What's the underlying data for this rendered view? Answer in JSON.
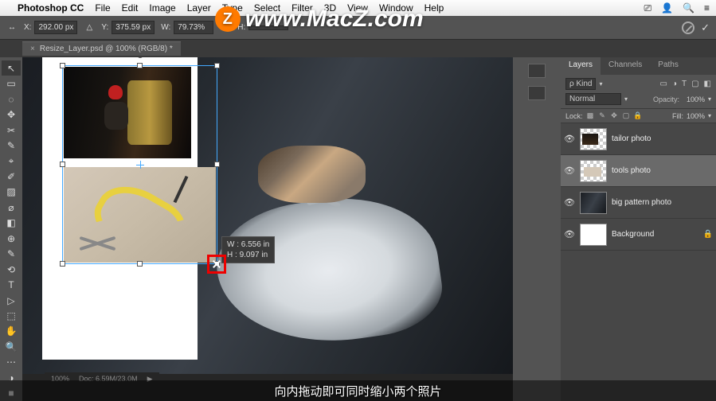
{
  "menubar": {
    "apple": "",
    "app": "Photoshop CC",
    "items": [
      "File",
      "Edit",
      "Image",
      "Layer",
      "Type",
      "Select",
      "Filter",
      "3D",
      "View",
      "Window",
      "Help"
    ],
    "right_icons": [
      "ext",
      "wifi",
      "spotlight",
      "menu"
    ]
  },
  "options": {
    "x_label": "X:",
    "x": "292.00 px",
    "y_label": "Y:",
    "y": "375.59 px",
    "w_label": "W:",
    "w": "79.73%",
    "h_label": "H:"
  },
  "tab": {
    "title": "Resize_Layer.psd @ 100% (RGB/8) *"
  },
  "tools": [
    "↖",
    "▭",
    "◌",
    "✥",
    "✂",
    "✎",
    "⌖",
    "✐",
    "▨",
    "⌀",
    "◧",
    "⊕",
    "✎",
    "⟲",
    "T",
    "▷",
    "⬚",
    "✋",
    "🔍",
    "⋯",
    "◑",
    "■",
    "□",
    "▤"
  ],
  "transform_tooltip": {
    "w_label": "W :",
    "w": "6.556 in",
    "h_label": "H :",
    "h": "9.097 in"
  },
  "panels": {
    "tabs": [
      "Layers",
      "Channels",
      "Paths"
    ],
    "active_tab": "Layers",
    "filter": {
      "kind_label": "ρ Kind",
      "icons": [
        "▭",
        "◑",
        "T",
        "▢",
        "◧"
      ]
    },
    "blend": {
      "mode": "Normal",
      "opacity_label": "Opacity:",
      "opacity": "100%"
    },
    "lock": {
      "label": "Lock:",
      "fill_label": "Fill:",
      "fill": "100%"
    },
    "layers": [
      {
        "name": "tailor photo",
        "transparent": true
      },
      {
        "name": "tools photo",
        "transparent": true,
        "selected": true
      },
      {
        "name": "big pattern photo",
        "transparent": false
      },
      {
        "name": "Background",
        "transparent": false,
        "locked": true
      }
    ]
  },
  "status": {
    "zoom": "100%",
    "doc": "Doc: 6.59M/23.0M"
  },
  "subtitle": "向内拖动即可同时缩小两个照片",
  "watermark": "www.MacZ.com"
}
